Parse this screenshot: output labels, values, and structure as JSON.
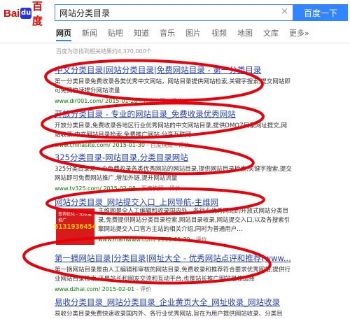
{
  "logo": {
    "left": "Bai",
    "paw": "du",
    "right": "百度"
  },
  "search": {
    "value": "网站分类目录",
    "clear": "×",
    "button": "百度一下"
  },
  "tabs": [
    "网页",
    "新闻",
    "贴吧",
    "知道",
    "音乐",
    "图片",
    "视频",
    "地图",
    "文库",
    "更多»"
  ],
  "results_count": "百度为您找到相关结果约4,370,000个",
  "results": [
    {
      "title": "中文分类目录|网站分类目录|免费网站目录 - 第一分类目录",
      "snippet": "第一分类目录免费收录各类优秀中文网站，网站目录提供网站检索,关键字搜索,提交网站即可免费快速提升网站流量",
      "url": "www.dir001.com/ 2015-01-28",
      "extra": "- 百度快照 - 评价"
    },
    {
      "title": "开放分类目录 - 专业的网站目录_免费收录优秀网站",
      "snippet": "开放分类目录,免费收录各地区行业优秀网站的中文网站目录,提供DMOZ目录网址提交,网站收录,中文网站目录检索,免费推广网站,分享互联网",
      "url": "www.chinasite.com/ 2015-01-30",
      "extra": "- 百度快照 - 评价"
    },
    {
      "title": "325分类目录-网站目录,分类目录网站",
      "snippet": "325分类目录是一个免费收录各类优秀网站的网站目录,提供网站目录检索,关键字搜索,提交网站即可免费网站推广,增加外链,提升网站流量",
      "url": "www.tv325.com/ 2015-02-08",
      "extra": "- 百度快照 - 评价"
    },
    {
      "title": "网站分类目录_网站提交入口_上网导航-主维网",
      "snippet": "主维网是全人工编辑和收录国内外、各行业优秀网站的开放式网站分类目录,免费提供网站分类目录检索,网站目录收录,网站提交入口,以及各搜索引擎网站提交入口官方主站的相关介绍,同时为普通用户...",
      "url": "www.mainwww.com/ 2015-01-30",
      "extra": "- 评价"
    },
    {
      "title": "第一摘网站目录|分类目录|网址大全 - 优秀网站点评和推荐(www...",
      "snippet": "第一摘网站目录是由人工编辑和审核的网站目录,免费收录和推荐符合要求优秀网站,提供行业网站目录检索,还是站长和网友交流和互动平台,也是站长推广网站最佳选择",
      "url": "www.dzhai.com/ 2015-02-01",
      "extra": "- 评价"
    },
    {
      "title": "易收分类目录_网站分类目录_企业黄页大全_网址收录_网站收录",
      "snippet": "易收分类目录免费快速收录国内外、各行业优秀网站,旨在为用户提供网站收录、分类目录、优秀网站",
      "url": "",
      "extra": ""
    }
  ],
  "thumb": {
    "top": "查询优化 - 无限量推广",
    "phone": "5131936454"
  },
  "colors": {
    "accent": "#3385ff",
    "link": "#2440b3",
    "highlight": "#cc0000",
    "url": "#008000",
    "annotation": "#e8000b"
  }
}
